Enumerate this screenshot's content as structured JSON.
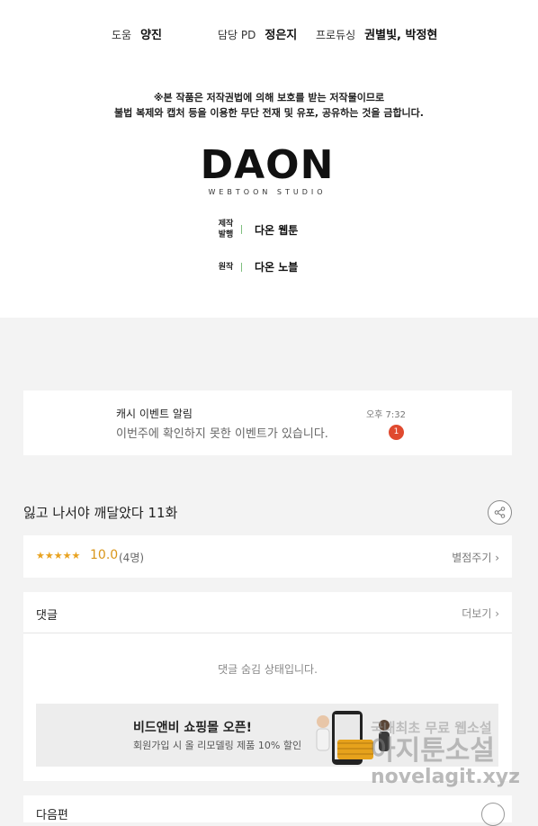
{
  "credits": {
    "assist_label": "도움",
    "assist_value": "양진",
    "pd_label": "담당 PD",
    "pd_value": "정은지",
    "producing_label": "프로듀싱",
    "producing_value": "권별빛, 박정현"
  },
  "notice": {
    "line1": "※본 작품은 저작권법에 의해 보호를 받는 저작물이므로",
    "line2": "불법 복제와 캡처 등을 이용한 무단 전재 및 유포, 공유하는 것을 금합니다."
  },
  "logo": {
    "main": "DAON",
    "sub": "WEBTOON STUDIO"
  },
  "meta": {
    "production_label_1": "제작",
    "production_label_2": "발행",
    "production_value": "다온 웹툰",
    "original_label": "원작",
    "original_value": "다온 노블",
    "bar_color": "#7fbf7f"
  },
  "notification": {
    "title": "캐시 이벤트 알림",
    "message": "이번주에 확인하지 못한 이벤트가 있습니다.",
    "time": "오후 7:32",
    "badge": "1"
  },
  "episode": {
    "title": "잃고 나서야 깨달았다 11화",
    "share_icon": "share-icon"
  },
  "rating": {
    "stars": "★★★★★",
    "score": "10.0",
    "count": "(4명)",
    "rate_label": "별점주기 ›",
    "star_color": "#e8a21f"
  },
  "comments": {
    "header": "댓글",
    "more_label": "더보기 ›",
    "hidden_text": "댓글 숨김 상태입니다."
  },
  "ad": {
    "headline": "비드앤비 쇼핑몰 오픈!",
    "subline": "회원가입 시 올 리모델링 제품 10% 할인"
  },
  "next": {
    "label": "다음편"
  },
  "watermark": {
    "line1": "국내최초 무료 웹소설",
    "line2": "아지툰소설",
    "line3": "novelagit.xyz"
  }
}
